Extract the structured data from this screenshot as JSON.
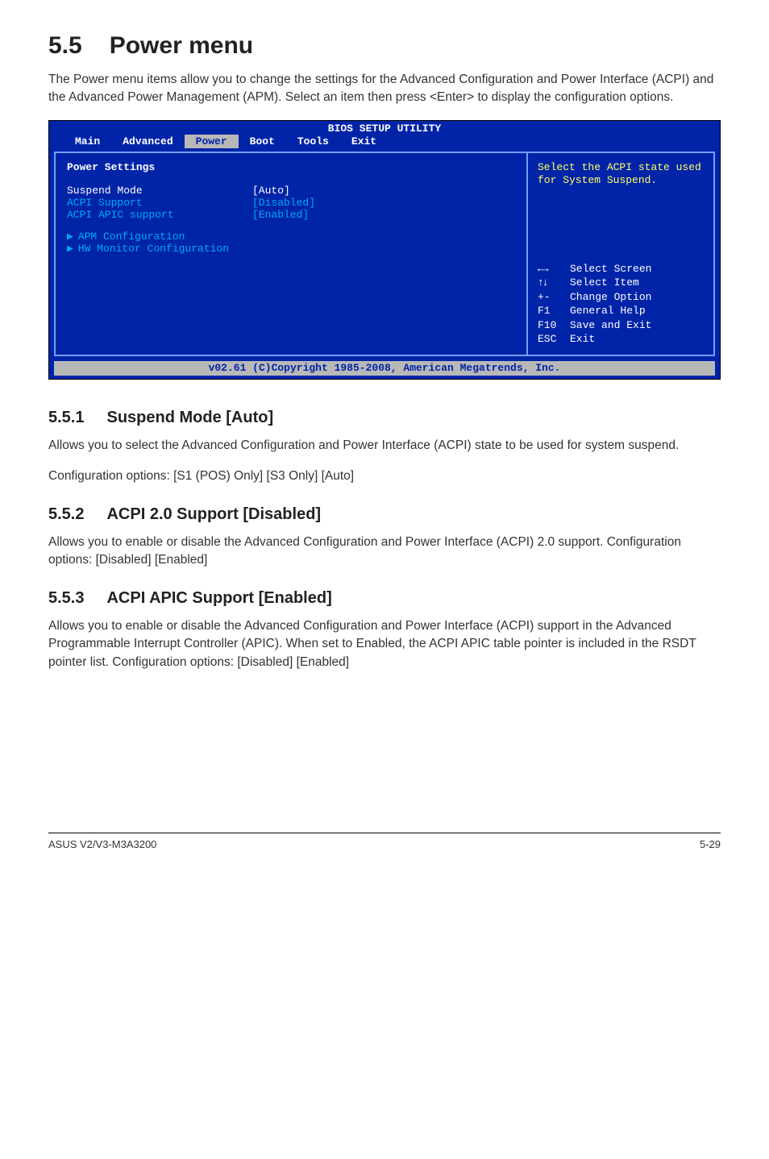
{
  "section": {
    "number": "5.5",
    "title": "Power menu",
    "intro": "The Power menu items allow you to change the settings for the Advanced Configuration and Power Interface (ACPI) and the Advanced Power Management (APM). Select an item then press <Enter> to display the configuration options."
  },
  "bios": {
    "header": "BIOS SETUP UTILITY",
    "menu": [
      "Main",
      "Advanced",
      "Power",
      "Boot",
      "Tools",
      "Exit"
    ],
    "active_menu": "Power",
    "panel_heading": "Power Settings",
    "rows": [
      {
        "label": "Suspend Mode",
        "value": "[Auto]",
        "selected": true
      },
      {
        "label": "ACPI Support",
        "value": "[Disabled]",
        "selected": false
      },
      {
        "label": "ACPI APIC support",
        "value": "[Enabled]",
        "selected": false
      }
    ],
    "subitems": [
      "APM Configuration",
      "HW Monitor Configuration"
    ],
    "help": "Select the ACPI state used for System Suspend.",
    "keys": [
      {
        "k": "←→",
        "t": "Select Screen"
      },
      {
        "k": "↑↓",
        "t": "Select Item"
      },
      {
        "k": "+-",
        "t": "Change Option"
      },
      {
        "k": "F1",
        "t": "General Help"
      },
      {
        "k": "F10",
        "t": "Save and Exit"
      },
      {
        "k": "ESC",
        "t": "Exit"
      }
    ],
    "footer": "v02.61 (C)Copyright 1985-2008, American Megatrends, Inc."
  },
  "subsections": [
    {
      "num": "5.5.1",
      "title": "Suspend Mode [Auto]",
      "paras": [
        "Allows you to select the Advanced Configuration and Power Interface (ACPI) state to be used for system suspend.",
        "Configuration options: [S1 (POS) Only] [S3 Only] [Auto]"
      ]
    },
    {
      "num": "5.5.2",
      "title": "ACPI 2.0 Support [Disabled]",
      "paras": [
        "Allows you to enable or disable the Advanced Configuration and Power Interface (ACPI) 2.0 support. Configuration options: [Disabled] [Enabled]"
      ]
    },
    {
      "num": "5.5.3",
      "title": "ACPI APIC Support [Enabled]",
      "paras": [
        "Allows you to enable or disable the Advanced Configuration and Power Interface (ACPI) support in the Advanced Programmable Interrupt Controller (APIC). When set to Enabled, the ACPI APIC table pointer is included in the RSDT pointer list. Configuration options: [Disabled] [Enabled]"
      ]
    }
  ],
  "footer": {
    "left": "ASUS V2/V3-M3A3200",
    "right": "5-29"
  }
}
